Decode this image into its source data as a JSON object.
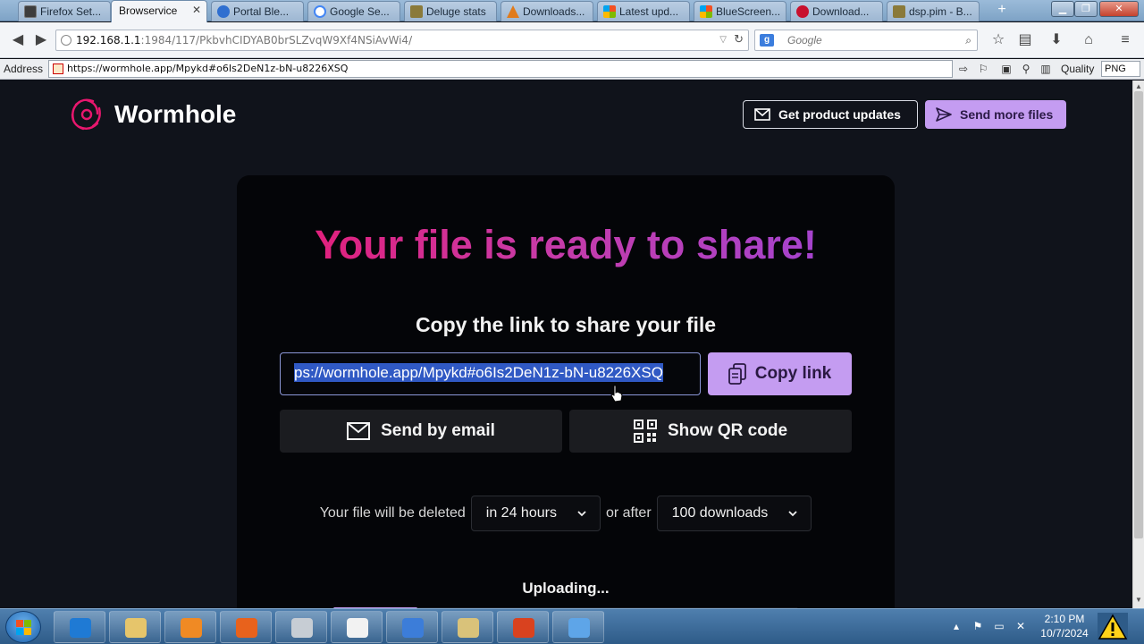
{
  "browser": {
    "tabs": [
      {
        "label": "Firefox Set...",
        "active": false,
        "color": "#3d3d3d"
      },
      {
        "label": "Browservice",
        "active": true,
        "color": "#ffffff"
      },
      {
        "label": "Portal Ble...",
        "active": false,
        "color": "#2f6fd0"
      },
      {
        "label": "Google Se...",
        "active": false,
        "color": "#ffffff"
      },
      {
        "label": "Deluge stats",
        "active": false,
        "color": "#8a7a3a"
      },
      {
        "label": "Downloads...",
        "active": false,
        "color": "#e07b1c"
      },
      {
        "label": "Latest upd...",
        "active": false,
        "color": "#d83b01"
      },
      {
        "label": "BlueScreen...",
        "active": false,
        "color": "#d83b01"
      },
      {
        "label": "Download...",
        "active": false,
        "color": "#c8102e"
      },
      {
        "label": "dsp.pim - B...",
        "active": false,
        "color": "#8a7a3a"
      }
    ],
    "tab_close": "✕",
    "new_tab": "+",
    "url": {
      "host": "192.168.1.1",
      "rest": ":1984/117/PkbvhCIDYAB0brSLZvqW9Xf4NSiAvWi4/"
    },
    "search_placeholder": "Google",
    "search_engine_letter": "g"
  },
  "address_toolbar": {
    "label": "Address",
    "value": "https://wormhole.app/Mpykd#o6Is2DeN1z-bN-u8226XSQ",
    "quality_label": "Quality",
    "format": "PNG"
  },
  "page": {
    "logo_text": "Wormhole",
    "header_buttons": {
      "updates": "Get product updates",
      "more": "Send more files"
    },
    "headline": "Your file is ready to share!",
    "subhead": "Copy the link to share your file",
    "link_value": "ps://wormhole.app/Mpykd#o6Is2DeN1z-bN-u8226XSQ",
    "copy_label": "Copy link",
    "email_label": "Send by email",
    "qr_label": "Show QR code",
    "expiry": {
      "prefix": "Your file will be deleted",
      "time_option": "in 24 hours",
      "joiner": "or after",
      "downloads_option": "100 downloads"
    },
    "status": "Uploading...",
    "progress_fraction": 0.18,
    "colors": {
      "accent": "#c49cf1",
      "headline_start": "#e9176e",
      "headline_end": "#9b46d8",
      "background": "#10131b"
    }
  },
  "taskbar": {
    "apps": [
      {
        "name": "ie-icon",
        "color": "#1f7ad4"
      },
      {
        "name": "explorer-icon",
        "color": "#e6c56b"
      },
      {
        "name": "media-player-icon",
        "color": "#f08a24"
      },
      {
        "name": "firefox-icon",
        "color": "#e8621c"
      },
      {
        "name": "drive-icon",
        "color": "#c7cdd4"
      },
      {
        "name": "panda-icon",
        "color": "#f2f2f2"
      },
      {
        "name": "network-icon",
        "color": "#3c7dd9"
      },
      {
        "name": "paint-icon",
        "color": "#d9c27a"
      },
      {
        "name": "flashget-icon",
        "color": "#d9421f"
      },
      {
        "name": "windows-update-icon",
        "color": "#5ea5e8"
      }
    ],
    "time": "2:10 PM",
    "date": "10/7/2024"
  }
}
